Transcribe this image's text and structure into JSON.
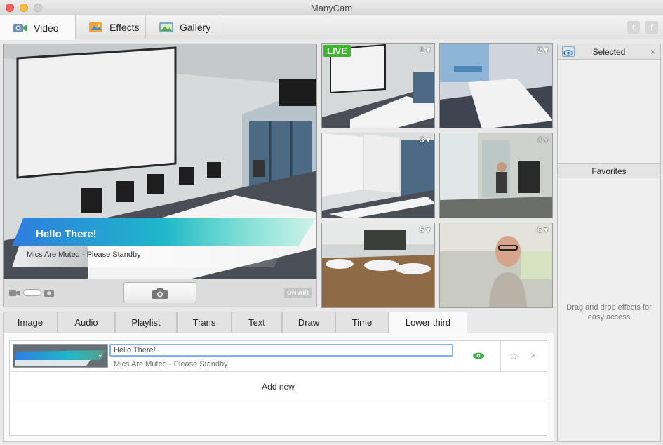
{
  "window": {
    "title": "ManyCam"
  },
  "main_tabs": [
    {
      "label": "Video",
      "icon": "video-camera-icon",
      "active": true
    },
    {
      "label": "Effects",
      "icon": "effects-icon",
      "active": false
    },
    {
      "label": "Gallery",
      "icon": "gallery-icon",
      "active": false
    }
  ],
  "social": {
    "twitter_icon": "twitter-icon",
    "facebook_icon": "facebook-icon"
  },
  "preview": {
    "lower_third_title": "Hello There!",
    "lower_third_subtitle": "Mics Are Muted - Please Standby",
    "on_air_label": "ON AIR"
  },
  "sources": {
    "live_label": "LIVE",
    "cells": [
      {
        "number": "1"
      },
      {
        "number": "2"
      },
      {
        "number": "3"
      },
      {
        "number": "4"
      },
      {
        "number": "5"
      },
      {
        "number": "6"
      }
    ]
  },
  "right_panel": {
    "selected_label": "Selected",
    "favorites_label": "Favorites",
    "drop_hint": "Drag and drop effects for easy access"
  },
  "sub_tabs": [
    {
      "label": "Image"
    },
    {
      "label": "Audio"
    },
    {
      "label": "Playlist"
    },
    {
      "label": "Trans"
    },
    {
      "label": "Text"
    },
    {
      "label": "Draw"
    },
    {
      "label": "Time"
    },
    {
      "label": "Lower third",
      "active": true
    }
  ],
  "lower_third_editor": {
    "title_value": "Hello There!",
    "subtitle_value": "Mics Are Muted - Please Standby",
    "add_new_label": "Add new"
  },
  "colors": {
    "live_green": "#3eb52d",
    "eye_green": "#3fae49",
    "lower_third_teal": "#1fb7c9",
    "input_focus_blue": "#7fb3e6"
  }
}
